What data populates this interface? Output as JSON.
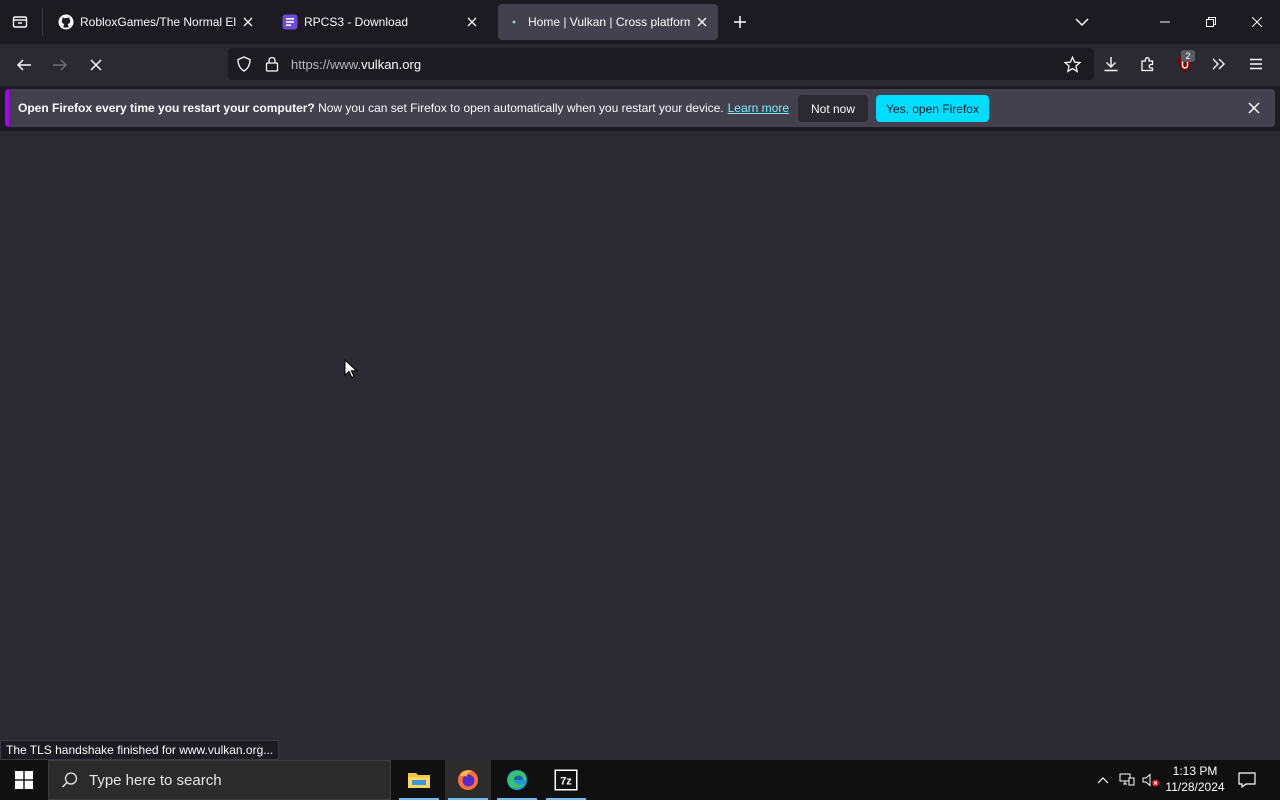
{
  "tabs": [
    {
      "title": "RobloxGames/The Normal Elev",
      "favicon": "github-icon"
    },
    {
      "title": "RPCS3 - Download",
      "favicon": "rpcs3-icon"
    },
    {
      "title": "Home | Vulkan | Cross platform",
      "favicon": "loading-icon",
      "active": true
    }
  ],
  "address": {
    "prefix": "https://www.",
    "host": "vulkan.org"
  },
  "extensions_badge": "2",
  "notification": {
    "bold": "Open Firefox every time you restart your computer?",
    "message": " Now you can set Firefox to open automatically when you restart your device.",
    "link": "Learn more",
    "not_now": "Not now",
    "yes": "Yes, open Firefox"
  },
  "status_text": "The TLS handshake finished for www.vulkan.org...",
  "taskbar": {
    "search_placeholder": "Type here to search",
    "time": "1:13 PM",
    "date": "11/28/2024"
  },
  "colors": {
    "accent": "#00ddff",
    "link": "#80ebff"
  }
}
